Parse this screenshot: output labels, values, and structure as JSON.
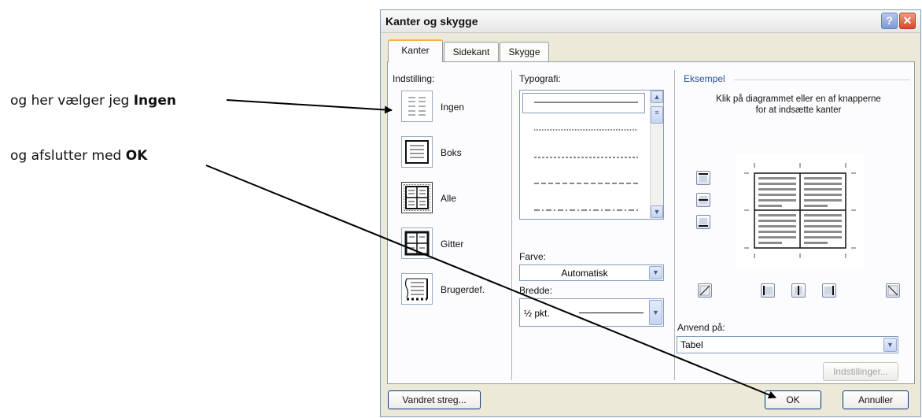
{
  "annotations": {
    "line1_text": "og her vælger jeg ",
    "line1_bold": "Ingen",
    "line2_text": "og afslutter med ",
    "line2_bold": "OK"
  },
  "dialog": {
    "title": "Kanter og skygge",
    "help_glyph": "?",
    "close_glyph": "✕",
    "tabs": [
      {
        "label": "Kanter",
        "active": true
      },
      {
        "label": "Sidekant",
        "active": false
      },
      {
        "label": "Skygge",
        "active": false
      }
    ],
    "setting": {
      "heading": "Indstilling:",
      "items": [
        {
          "label": "Ingen",
          "icon": "border-none-icon",
          "selected": false
        },
        {
          "label": "Boks",
          "icon": "border-box-icon",
          "selected": false
        },
        {
          "label": "Alle",
          "icon": "border-all-icon",
          "selected": true
        },
        {
          "label": "Gitter",
          "icon": "border-grid-icon",
          "selected": false
        },
        {
          "label": "Brugerdef.",
          "icon": "border-custom-icon",
          "selected": false
        }
      ]
    },
    "style": {
      "heading": "Typografi:",
      "options": [
        "solid",
        "dotted",
        "dashed-short",
        "dashed-medium",
        "dash-dot"
      ]
    },
    "color": {
      "label": "Farve:",
      "value": "Automatisk"
    },
    "width": {
      "label": "Bredde:",
      "value": "½ pkt."
    },
    "preview": {
      "heading": "Eksempel",
      "instructions": "Klik på diagrammet eller en af knapperne for at indsætte kanter"
    },
    "apply_to": {
      "label": "Anvend på:",
      "value": "Tabel"
    },
    "buttons": {
      "options": "Indstillinger...",
      "horizontal_line": "Vandret streg...",
      "ok": "OK",
      "cancel": "Annuller"
    },
    "colors": {
      "accent_tab": "#f0b43c",
      "preview_heading": "#1f4e9e",
      "close_red": "#d6492b"
    }
  }
}
